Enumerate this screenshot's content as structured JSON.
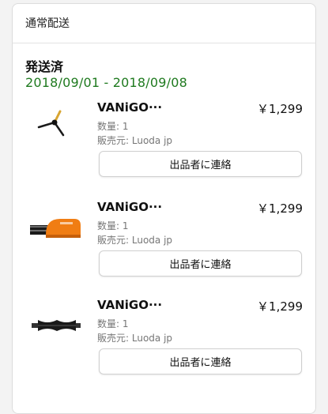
{
  "section_title": "通常配送",
  "shipment": {
    "status": "発送済",
    "date_range": "2018/09/01 - 2018/09/08"
  },
  "items": [
    {
      "name": "VANiGO···",
      "price": "￥1,299",
      "quantity": "数量: 1",
      "seller": "販売元: Luoda jp",
      "contact_label": "出品者に連絡",
      "image_icon": "side-brush-icon"
    },
    {
      "name": "VANiGO···",
      "price": "￥1,299",
      "quantity": "数量: 1",
      "seller": "販売元: Luoda jp",
      "contact_label": "出品者に連絡",
      "image_icon": "orange-brush-icon"
    },
    {
      "name": "VANiGO···",
      "price": "￥1,299",
      "quantity": "数量: 1",
      "seller": "販売元: Luoda jp",
      "contact_label": "出品者に連絡",
      "image_icon": "roller-brush-icon"
    }
  ],
  "colors": {
    "date_green": "#1f7a1f",
    "brush_orange": "#f07d13"
  }
}
